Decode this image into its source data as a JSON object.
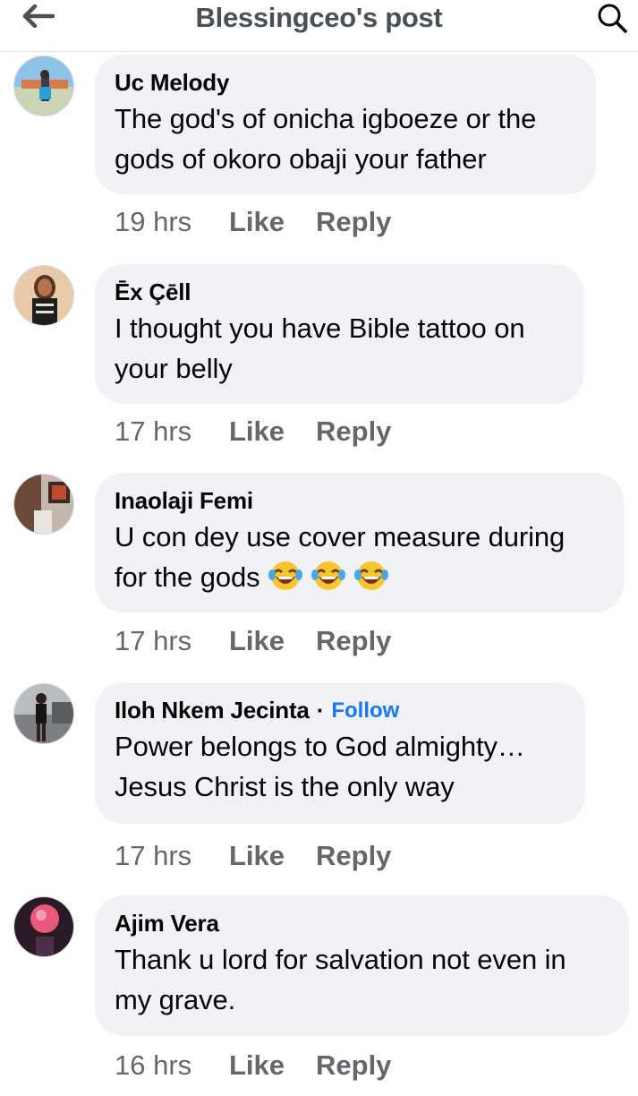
{
  "header": {
    "title": "Blessingceo's post",
    "back_icon": "arrow-left-icon",
    "search_icon": "search-icon"
  },
  "comments": [
    {
      "author": "Uc Melody",
      "text": "The god's of onicha igboeze or the gods of okoro obaji your father",
      "time": "19 hrs",
      "like": "Like",
      "reply": "Reply"
    },
    {
      "author": "Ēx Çēll",
      "text": "I thought you have Bible tattoo on your belly",
      "time": "17 hrs",
      "like": "Like",
      "reply": "Reply"
    },
    {
      "author": "Inaolaji Femi",
      "text": "U con dey use cover measure during for the gods",
      "emoji": [
        "😂",
        "😂",
        "😂"
      ],
      "time": "17 hrs",
      "like": "Like",
      "reply": "Reply"
    },
    {
      "author": "Iloh Nkem Jecinta",
      "separator": "·",
      "follow": "Follow",
      "text": "Power belongs to God almighty… Jesus Christ is the only way",
      "time": "17 hrs",
      "like": "Like",
      "reply": "Reply"
    },
    {
      "author": "Ajim Vera",
      "text": "Thank u lord for salvation not even in my grave.",
      "time": "16 hrs",
      "like": "Like",
      "reply": "Reply"
    }
  ],
  "colors": {
    "bubble": "#f0f2f5",
    "meta": "#65676b",
    "link": "#1877f2",
    "title": "#4b4f56"
  }
}
